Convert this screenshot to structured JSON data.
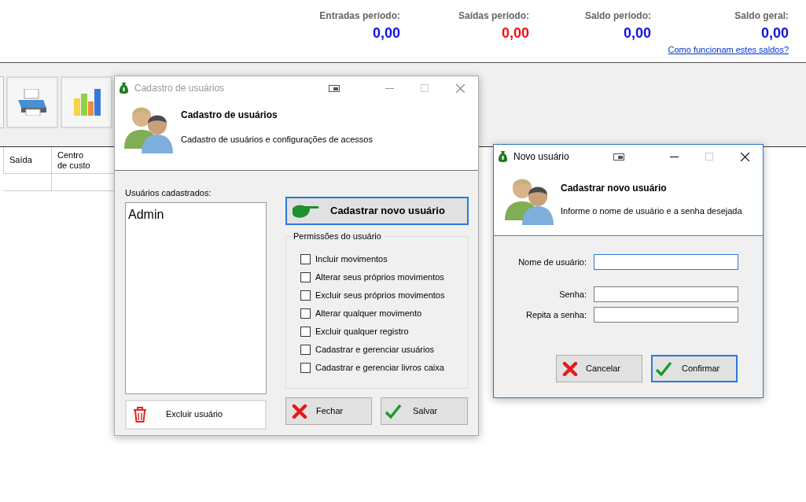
{
  "summary": [
    {
      "label": "Entradas período:",
      "value": "0,00",
      "color": "#1010e0"
    },
    {
      "label": "Saídas período:",
      "value": "0,00",
      "color": "#f01010"
    },
    {
      "label": "Saldo período:",
      "value": "0,00",
      "color": "#1010e0"
    },
    {
      "label": "Saldo geral:",
      "value": "0,00",
      "color": "#1010e0"
    }
  ],
  "summary_link": "Como funcionam estes saldos?",
  "table": {
    "columns": [
      "Saída",
      "Centro de custo"
    ]
  },
  "users_window": {
    "title": "Cadastro de usuários",
    "active": false,
    "header_title": "Cadastro de usuários",
    "header_subtitle": "Cadastro de usuários e configurações de acessos",
    "users_label": "Usuários cadastrados:",
    "users": [
      "Admin"
    ],
    "new_user_button": "Cadastrar novo usuário",
    "delete_button": "Excluir usuário",
    "permissions_title": "Permissões do usuário",
    "permissions": [
      {
        "label": "Incluir movimentos",
        "checked": false
      },
      {
        "label": "Alterar seus próprios movimentos",
        "checked": false
      },
      {
        "label": "Excluir seus próprios movimentos",
        "checked": false
      },
      {
        "label": "Alterar qualquer movimento",
        "checked": false
      },
      {
        "label": "Excluir qualquer registro",
        "checked": false
      },
      {
        "label": "Cadastrar e gerenciar usuários",
        "checked": false
      },
      {
        "label": "Cadastrar e gerenciar livros caixa",
        "checked": false
      }
    ],
    "close_button": "Fechar",
    "save_button": "Salvar"
  },
  "new_user_window": {
    "title": "Novo usuário",
    "active": true,
    "header_title": "Cadastrar novo usuário",
    "header_subtitle": "Informe o nome de usuário e a senha desejada",
    "fields": [
      {
        "label": "Nome de usuário:",
        "focused": true
      },
      {
        "label": "Senha:",
        "focused": false
      },
      {
        "label": "Repita a senha:",
        "focused": false
      }
    ],
    "cancel_button": "Cancelar",
    "confirm_button": "Confirmar"
  }
}
